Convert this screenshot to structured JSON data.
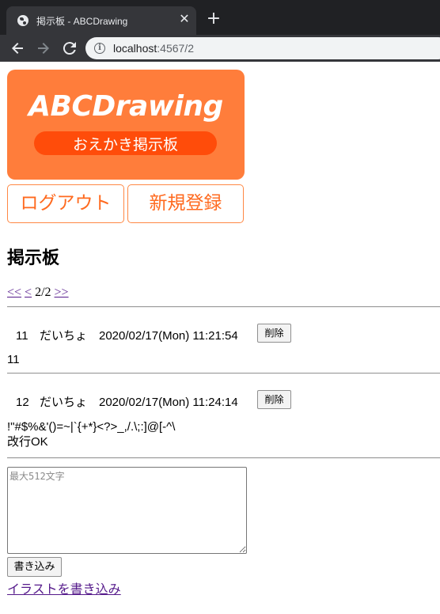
{
  "browser": {
    "tab_title": "掲示板 - ABCDrawing",
    "tab_close": "✕",
    "new_tab": "+",
    "url_host": "localhost",
    "url_path": ":4567/2"
  },
  "header": {
    "logo_title": "ABCDrawing",
    "logo_subtitle": "おえかき掲示板",
    "logout_label": "ログアウト",
    "register_label": "新規登録"
  },
  "main": {
    "title": "掲示板",
    "pager": {
      "first": "<<",
      "prev": "<",
      "current": "2/2",
      "next": ">>"
    },
    "posts": [
      {
        "no": "11",
        "name": "だいちょ",
        "date": "2020/02/17(Mon) 11:21:54",
        "delete_label": "削除",
        "body": "11"
      },
      {
        "no": "12",
        "name": "だいちょ",
        "date": "2020/02/17(Mon) 11:24:14",
        "delete_label": "削除",
        "body": "!\"#$%&'()=~|`{+*}<?>_,/.\\;:]@[-^\\\n改行OK"
      }
    ],
    "form": {
      "placeholder": "最大512文字",
      "submit_label": "書き込み",
      "illust_link": "イラストを書き込み"
    }
  },
  "colors": {
    "logo_bg": "#ff7d3b",
    "logo_pill": "#ff4c0a",
    "button_text": "#ff6a1f",
    "visited_link": "#551a8b"
  }
}
